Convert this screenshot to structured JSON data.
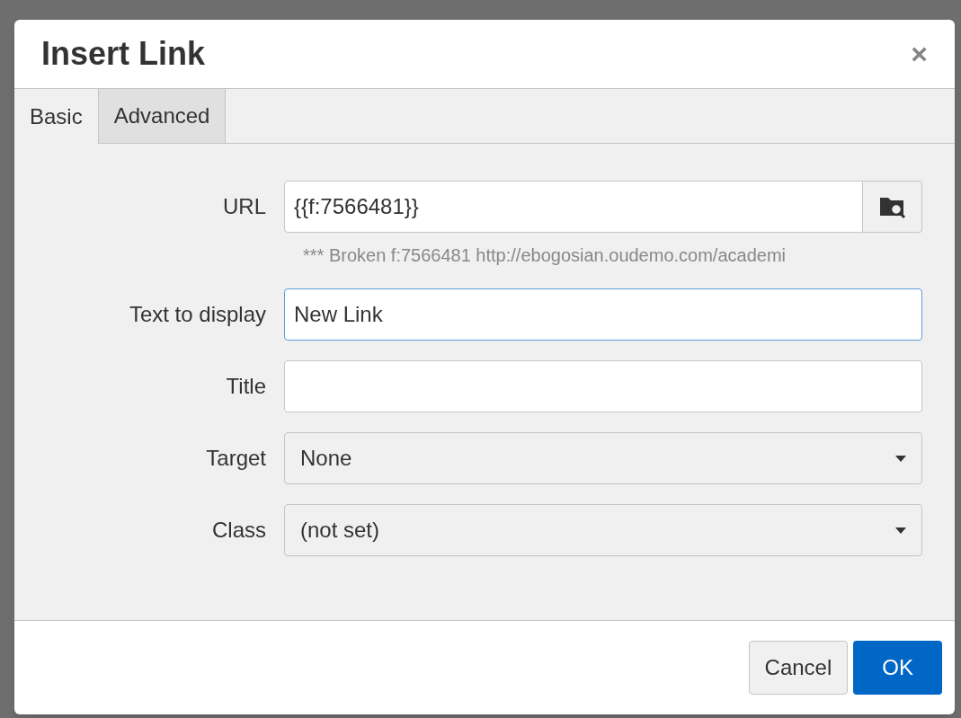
{
  "dialog": {
    "title": "Insert Link",
    "close": "×"
  },
  "tabs": [
    {
      "label": "Basic",
      "selected": true
    },
    {
      "label": "Advanced",
      "selected": false
    }
  ],
  "fields": [
    {
      "kind": "browse",
      "label": "URL",
      "value": "{{f:7566481}}",
      "focused": false,
      "hint": "*** Broken f:7566481 http://ebogosian.oudemo.com/academi"
    },
    {
      "kind": "text",
      "label": "Text to display",
      "value": "New Link",
      "focused": true
    },
    {
      "kind": "text",
      "label": "Title",
      "focused": false
    },
    {
      "kind": "select",
      "label": "Target",
      "value": "None",
      "focused": false
    },
    {
      "kind": "select",
      "label": "Class",
      "value": "(not set)",
      "focused": false
    }
  ],
  "buttons": [
    {
      "label": "Cancel",
      "kind": "default"
    },
    {
      "label": "OK",
      "kind": "primary"
    }
  ]
}
